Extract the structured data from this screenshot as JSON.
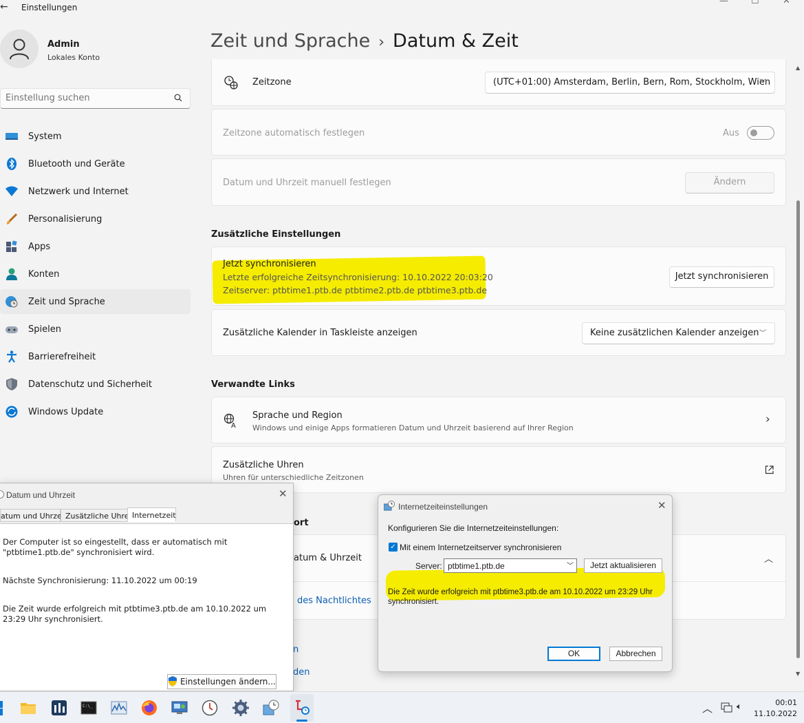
{
  "window": {
    "title": "Einstellungen"
  },
  "profile": {
    "name": "Admin",
    "account_type": "Lokales Konto"
  },
  "search": {
    "placeholder": "Einstellung suchen"
  },
  "nav": [
    {
      "label": "System",
      "icon": "monitor-icon"
    },
    {
      "label": "Bluetooth und Geräte",
      "icon": "bluetooth-icon"
    },
    {
      "label": "Netzwerk und Internet",
      "icon": "wifi-icon"
    },
    {
      "label": "Personalisierung",
      "icon": "brush-icon"
    },
    {
      "label": "Apps",
      "icon": "apps-icon"
    },
    {
      "label": "Konten",
      "icon": "person-icon"
    },
    {
      "label": "Zeit und Sprache",
      "icon": "globe-clock-icon"
    },
    {
      "label": "Spielen",
      "icon": "gamepad-icon"
    },
    {
      "label": "Barrierefreiheit",
      "icon": "accessibility-icon"
    },
    {
      "label": "Datenschutz und Sicherheit",
      "icon": "shield-icon"
    },
    {
      "label": "Windows Update",
      "icon": "update-icon"
    }
  ],
  "breadcrumb": {
    "parent": "Zeit und Sprache",
    "separator": "›",
    "current": "Datum & Zeit"
  },
  "timezone": {
    "label": "Zeitzone",
    "value": "(UTC+01:00) Amsterdam, Berlin, Bern, Rom, Stockholm, Wien"
  },
  "auto_timezone": {
    "label": "Zeitzone automatisch festlegen",
    "state": "Aus"
  },
  "manual_time": {
    "label": "Datum und Uhrzeit manuell festlegen",
    "button": "Ändern"
  },
  "additional_settings": {
    "title": "Zusätzliche Einstellungen",
    "sync": {
      "label": "Jetzt synchronisieren",
      "last_sync": "Letzte erfolgreiche Zeitsynchronisierung: 10.10.2022 20:03:20",
      "servers": "Zeitserver: ptbtime1.ptb.de ptbtime2.ptb.de ptbtime3.ptb.de",
      "button": "Jetzt synchronisieren"
    },
    "calendar": {
      "label": "Zusätzliche Kalender in Taskleiste anzeigen",
      "value": "Keine zusätzlichen Kalender anzeigen"
    }
  },
  "related_links": {
    "title": "Verwandte Links",
    "language": {
      "label": "Sprache und Region",
      "desc": "Windows und einige Apps formatieren Datum und Uhrzeit basierend auf Ihrer Region"
    },
    "clocks": {
      "label": "Zusätzliche Uhren",
      "desc": "Uhren für unterschiedliche Zeitzonen"
    }
  },
  "hidden_fragments": {
    "support": "ort",
    "datetime": "atum & Uhrzeit",
    "nightlight": "des Nachtlichtes",
    "frag1": "n",
    "frag2": "den"
  },
  "datetime_dialog": {
    "title": "Datum und Uhrzeit",
    "tabs": [
      "atum und Uhrzeit",
      "Zusätzliche Uhren",
      "Internetzeit"
    ],
    "configured_text": "Der Computer ist so eingestellt, dass er automatisch mit \"ptbtime1.ptb.de\" synchronisiert wird.",
    "next_sync": "Nächste Synchronisierung: 11.10.2022 um 00:19",
    "result": "Die Zeit wurde erfolgreich mit ptbtime3.ptb.de am 10.10.2022 um 23:29 Uhr synchronisiert.",
    "change_button": "Einstellungen ändern..."
  },
  "internet_time_dialog": {
    "title": "Internetzeiteinstellungen",
    "heading": "Konfigurieren Sie die Internetzeiteinstellungen:",
    "checkbox_label": "Mit einem Internetzeitserver synchronisieren",
    "server_label": "Server:",
    "server_value": "ptbtime1.ptb.de",
    "update_button": "Jetzt aktualisieren",
    "result": "Die Zeit wurde erfolgreich mit ptbtime3.ptb.de am 10.10.2022 um 23:29 Uhr synchronisiert.",
    "ok": "OK",
    "cancel": "Abbrechen"
  },
  "clock": {
    "time": "00:01",
    "date": "11.10.2022"
  }
}
